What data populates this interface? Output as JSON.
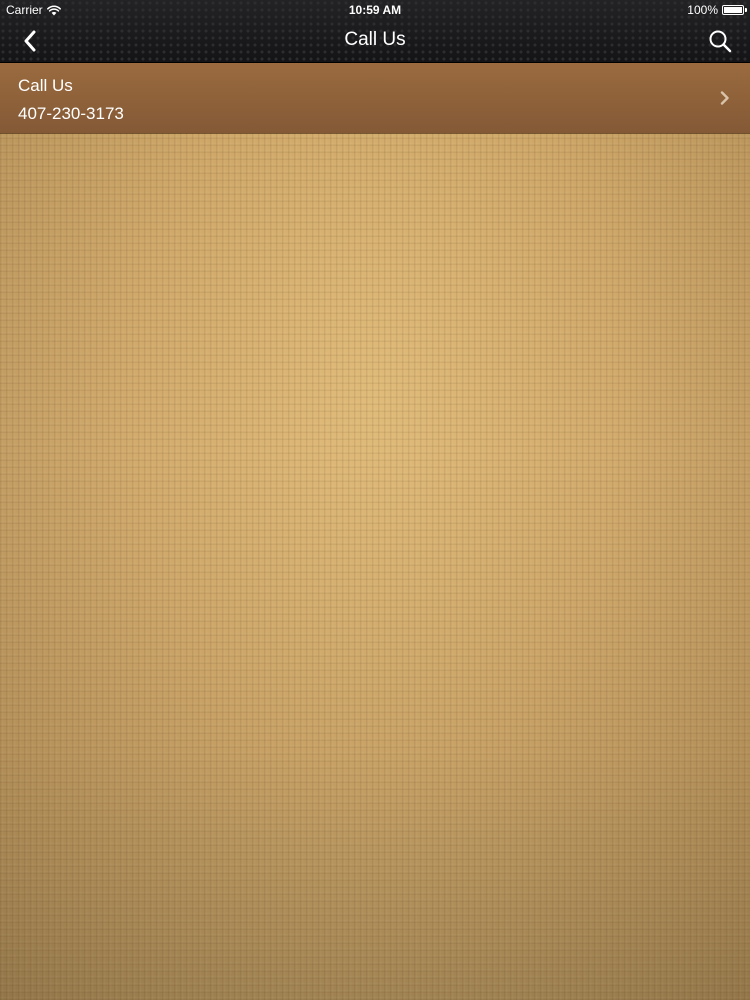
{
  "status_bar": {
    "carrier": "Carrier",
    "time": "10:59 AM",
    "battery": "100%",
    "battery_level": 1.0,
    "icons": {
      "wifi": "wifi-icon",
      "battery": "battery-icon"
    }
  },
  "nav_bar": {
    "title": "Call Us",
    "icons": {
      "back": "chevron-left-icon",
      "search": "search-icon"
    }
  },
  "list": {
    "items": [
      {
        "title": "Call Us",
        "subtitle": "407-230-3173",
        "icon": "chevron-right-icon"
      }
    ]
  },
  "colors": {
    "nav_background": "#1b1b1d",
    "row_background": "#8f623a",
    "page_background": "#c9a46a",
    "text": "#ffffff"
  }
}
